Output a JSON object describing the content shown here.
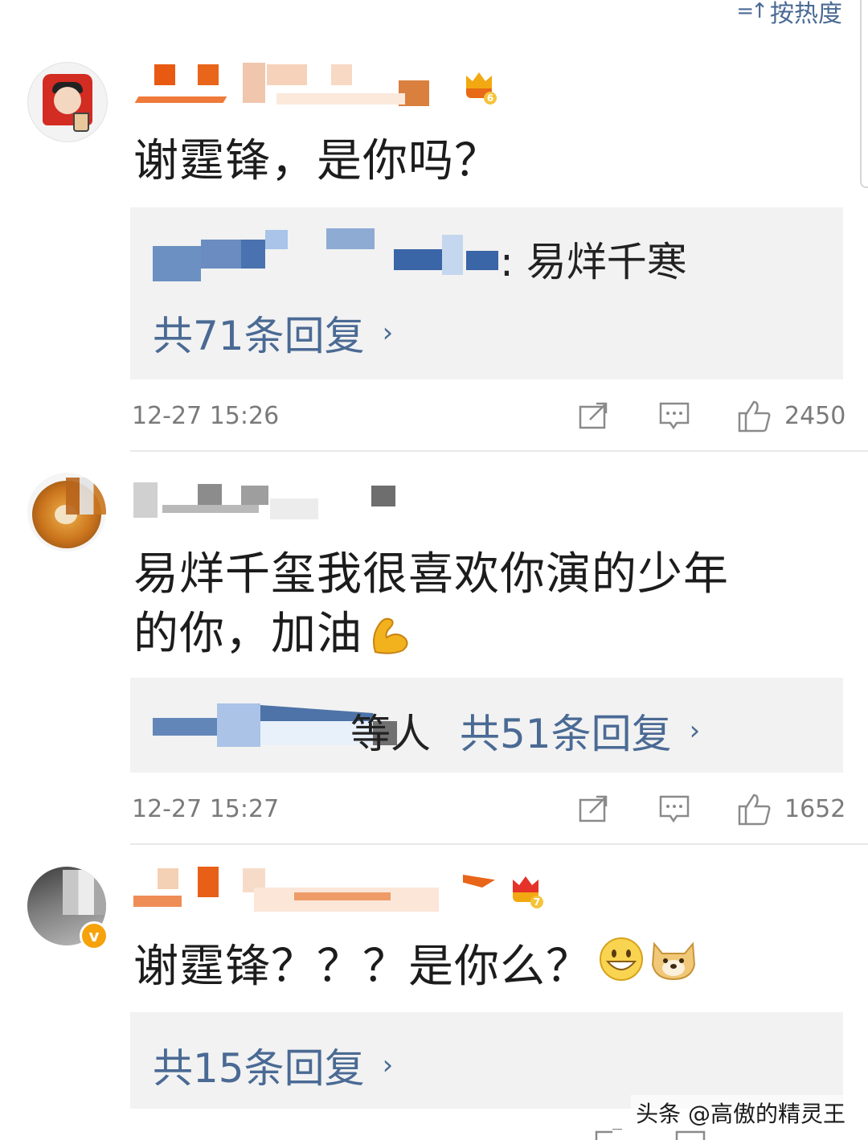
{
  "header": {
    "sort_label": "按热度"
  },
  "comments": [
    {
      "text": "谢霆锋，是你吗？",
      "reply_preview": {
        "suffix": ": 易烊千寒"
      },
      "more_replies": "共71条回复",
      "time": "12-27 15:26",
      "likes": "2450"
    },
    {
      "text_line1": "易烊千玺我很喜欢你演的少年",
      "text_line2": "的你，加油",
      "emoji": "muscle-emoji",
      "reply_preview": {
        "suffix": "等人"
      },
      "more_replies": "共51条回复",
      "time": "12-27 15:27",
      "likes": "1652"
    },
    {
      "text": "谢霆锋？？？是你么？",
      "emojis": [
        "grin-emoji",
        "doge-emoji"
      ],
      "more_replies": "共15条回复"
    }
  ],
  "watermark": "头条 @高傲的精灵王",
  "colors": {
    "link": "#4a6a94",
    "meta": "#7a7a7a",
    "reply_bg": "#f2f2f2",
    "crown": "#f2a911"
  }
}
